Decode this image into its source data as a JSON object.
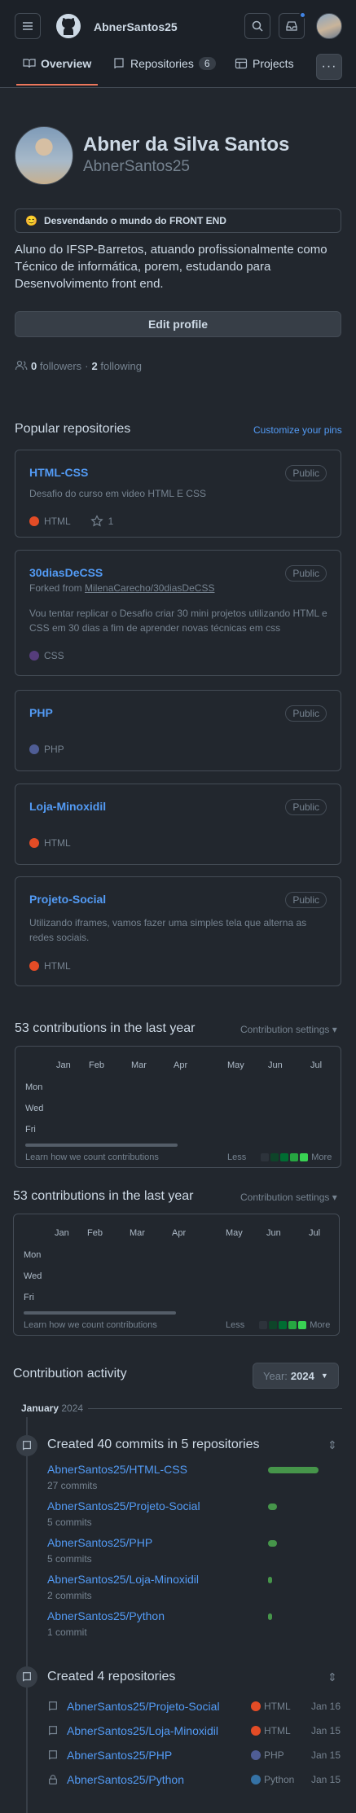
{
  "header": {
    "username": "AbnerSantos25",
    "tabs": [
      {
        "label": "Overview"
      },
      {
        "label": "Repositories",
        "count": "6"
      },
      {
        "label": "Projects"
      }
    ]
  },
  "profile": {
    "name": "Abner da Silva Santos",
    "login": "AbnerSantos25",
    "status_emoji": "😊",
    "status": "Desvendando o mundo do FRONT END",
    "bio": "Aluno do IFSP-Barretos, atuando profissionalmente como Técnico de informática, porem, estudando para Desenvolvimento front end.",
    "edit_label": "Edit profile",
    "followers_count": "0",
    "followers_label": "followers",
    "sep": "·",
    "following_count": "2",
    "following_label": "following"
  },
  "pinned": {
    "title": "Popular repositories",
    "customize_label": "Customize your pins",
    "repos": [
      {
        "name": "HTML-CSS",
        "badge": "Public",
        "desc": "Desafio do curso em video HTML E CSS",
        "lang": "HTML",
        "lang_color": "#e34c26",
        "stars": "1"
      },
      {
        "name": "30diasDeCSS",
        "badge": "Public",
        "forked_prefix": "Forked from",
        "forked_from": "MilenaCarecho/30diasDeCSS",
        "desc": "Vou tentar replicar o Desafio criar 30 mini projetos utilizando HTML e CSS em 30 dias a fim de aprender novas técnicas em css",
        "lang": "CSS",
        "lang_color": "#563d7c"
      },
      {
        "name": "PHP",
        "badge": "Public",
        "lang": "PHP",
        "lang_color": "#4f5d95"
      },
      {
        "name": "Loja-Minoxidil",
        "badge": "Public",
        "lang": "HTML",
        "lang_color": "#e34c26"
      },
      {
        "name": "Projeto-Social",
        "badge": "Public",
        "desc": "Utilizando iframes, vamos fazer uma simples tela que alterna as redes sociais.",
        "lang": "HTML",
        "lang_color": "#e34c26"
      }
    ]
  },
  "contributions": [
    {
      "title": "53 contributions in the last year",
      "settings_label": "Contribution settings ▾",
      "months": [
        "Jan",
        "Feb",
        "Mar",
        "Apr",
        "May",
        "Jun",
        "Jul"
      ],
      "days": [
        "Mon",
        "Wed",
        "Fri"
      ],
      "learn_label": "Learn how we count contributions",
      "less_label": "Less",
      "more_label": "More"
    },
    {
      "title": "53 contributions in the last year",
      "settings_label": "Contribution settings ▾",
      "months": [
        "Jan",
        "Feb",
        "Mar",
        "Apr",
        "May",
        "Jun",
        "Jul"
      ],
      "days": [
        "Mon",
        "Wed",
        "Fri"
      ],
      "learn_label": "Learn how we count contributions",
      "less_label": "Less",
      "more_label": "More"
    }
  ],
  "legend_colors": [
    "#2d333b",
    "#0e4429",
    "#006d32",
    "#26a641",
    "#39d353"
  ],
  "activity": {
    "title": "Contribution activity",
    "year_prefix": "Year:",
    "year": "2024",
    "month": "January",
    "month_year": "2024",
    "commits_title": "Created 40 commits in 5 repositories",
    "commits": [
      {
        "repo": "AbnerSantos25/HTML-CSS",
        "count": "27 commits",
        "fraction": 1.0
      },
      {
        "repo": "AbnerSantos25/Projeto-Social",
        "count": "5 commits",
        "fraction": 0.185
      },
      {
        "repo": "AbnerSantos25/PHP",
        "count": "5 commits",
        "fraction": 0.185
      },
      {
        "repo": "AbnerSantos25/Loja-Minoxidil",
        "count": "2 commits",
        "fraction": 0.074
      },
      {
        "repo": "AbnerSantos25/Python",
        "count": "1 commit",
        "fraction": 0.037
      }
    ],
    "repos_title": "Created 4 repositories",
    "created": [
      {
        "repo": "AbnerSantos25/Projeto-Social",
        "lang": "HTML",
        "color": "#e34c26",
        "date": "Jan 16",
        "icon": "repo-icon"
      },
      {
        "repo": "AbnerSantos25/Loja-Minoxidil",
        "lang": "HTML",
        "color": "#e34c26",
        "date": "Jan 15",
        "icon": "repo-icon"
      },
      {
        "repo": "AbnerSantos25/PHP",
        "lang": "PHP",
        "color": "#4f5d95",
        "date": "Jan 15",
        "icon": "repo-icon"
      },
      {
        "repo": "AbnerSantos25/Python",
        "lang": "Python",
        "color": "#3572a5",
        "date": "Jan 15",
        "icon": "lock-icon"
      }
    ]
  }
}
